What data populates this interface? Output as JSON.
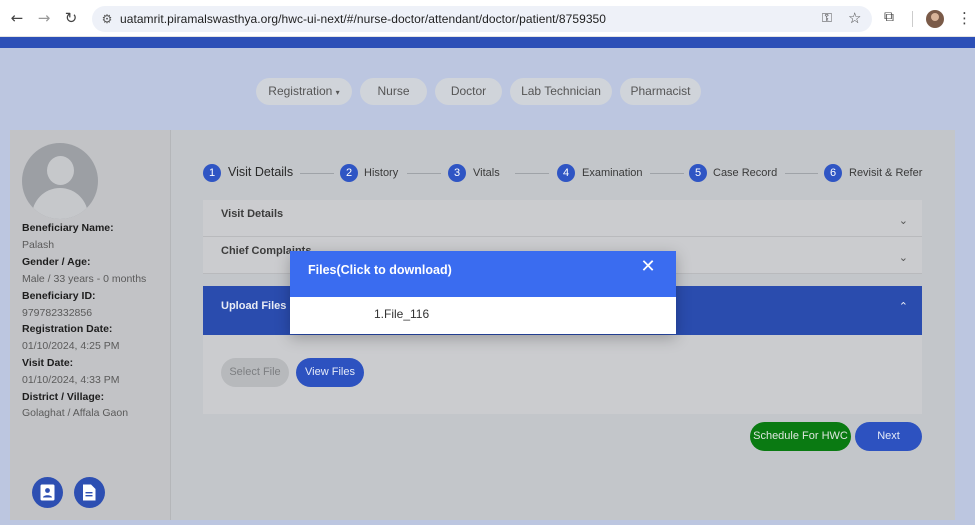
{
  "browser": {
    "url": "uatamrit.piramalswasthya.org/hwc-ui-next/#/nurse-doctor/attendant/doctor/patient/8759350"
  },
  "roles": [
    {
      "label": "Registration",
      "has_dropdown": true
    },
    {
      "label": "Nurse"
    },
    {
      "label": "Doctor"
    },
    {
      "label": "Lab Technician"
    },
    {
      "label": "Pharmacist"
    }
  ],
  "beneficiary": {
    "name_label": "Beneficiary Name:",
    "name_value": "Palash",
    "gender_label": "Gender / Age:",
    "gender_value": "Male / 33 years - 0 months",
    "id_label": "Beneficiary ID:",
    "id_value": "979782332856",
    "reg_label": "Registration Date:",
    "reg_value": "01/10/2024, 4:25 PM",
    "visit_label": "Visit Date:",
    "visit_value": "01/10/2024, 4:33 PM",
    "district_label": "District / Village:",
    "district_value": "Golaghat / Affala Gaon"
  },
  "steps": [
    {
      "num": "1",
      "label": "Visit Details"
    },
    {
      "num": "2",
      "label": "History"
    },
    {
      "num": "3",
      "label": "Vitals"
    },
    {
      "num": "4",
      "label": "Examination"
    },
    {
      "num": "5",
      "label": "Case Record"
    },
    {
      "num": "6",
      "label": "Revisit & Refer"
    }
  ],
  "accordions": {
    "visit_details": "Visit Details",
    "chief_complaints": "Chief Complaints",
    "upload_files": "Upload Files"
  },
  "buttons": {
    "select_file": "Select File",
    "view_files": "View Files",
    "schedule": "Schedule For HWC",
    "next": "Next"
  },
  "modal": {
    "title": "Files(Click to download)",
    "close": "✕",
    "files": [
      "1.File_116"
    ]
  },
  "colors": {
    "primary": "#2f55c4",
    "modal_header": "#3a6cf0",
    "schedule_green": "#0a7a12"
  }
}
